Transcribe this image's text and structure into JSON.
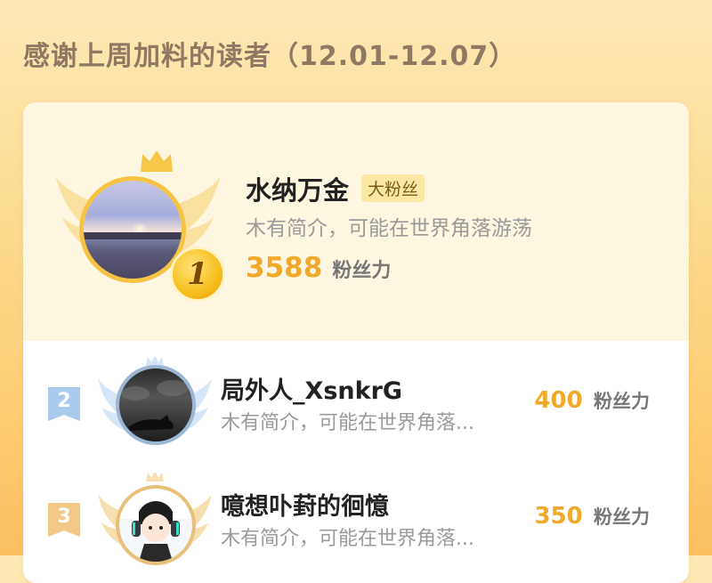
{
  "page": {
    "title": "感谢上周加料的读者（12.01-12.07）"
  },
  "colors": {
    "accent": "#f0a92a",
    "gold": "#f6c344",
    "silver": "#9cc0e8",
    "bronze": "#f0c780"
  },
  "ranking": [
    {
      "rank": "1",
      "name": "水纳万金",
      "badge": "大粉丝",
      "bio": "木有简介，可能在世界角落游荡",
      "fans_value": "3588",
      "fans_unit": "粉丝力",
      "avatar_icon": "sunset-photo-avatar"
    },
    {
      "rank": "2",
      "name": "局外人_XsnkrG",
      "bio": "木有简介，可能在世界角落...",
      "fans_value": "400",
      "fans_unit": "粉丝力",
      "avatar_icon": "cat-silhouette-avatar"
    },
    {
      "rank": "3",
      "name": "噫想卟葑的徊憶",
      "bio": "木有简介，可能在世界角落...",
      "fans_value": "350",
      "fans_unit": "粉丝力",
      "avatar_icon": "anime-headphones-avatar"
    }
  ]
}
